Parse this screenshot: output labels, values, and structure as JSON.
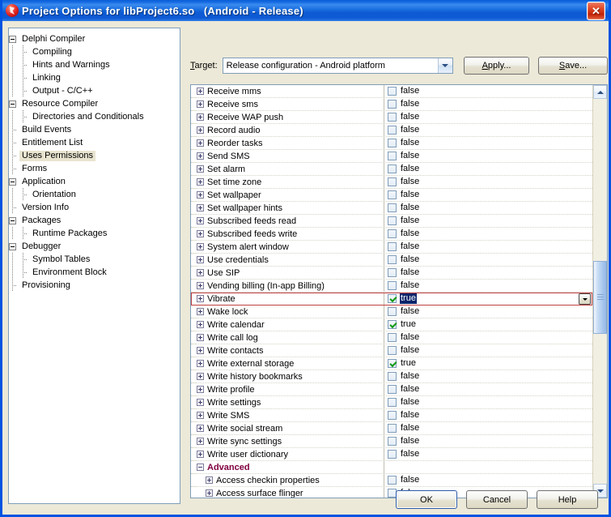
{
  "window": {
    "title": "Project Options for libProject6.so   (Android - Release)",
    "icon": "delphi-icon",
    "close_label": "✕"
  },
  "tree": {
    "items": [
      {
        "label": "Delphi Compiler",
        "level": 0,
        "expander": "minus",
        "selected": false
      },
      {
        "label": "Compiling",
        "level": 1,
        "expander": "none",
        "selected": false
      },
      {
        "label": "Hints and Warnings",
        "level": 1,
        "expander": "none",
        "selected": false
      },
      {
        "label": "Linking",
        "level": 1,
        "expander": "none",
        "selected": false
      },
      {
        "label": "Output - C/C++",
        "level": 1,
        "expander": "none",
        "selected": false
      },
      {
        "label": "Resource Compiler",
        "level": 0,
        "expander": "minus",
        "selected": false
      },
      {
        "label": "Directories and Conditionals",
        "level": 1,
        "expander": "none",
        "selected": false
      },
      {
        "label": "Build Events",
        "level": 0,
        "expander": "none",
        "selected": false
      },
      {
        "label": "Entitlement List",
        "level": 0,
        "expander": "none",
        "selected": false
      },
      {
        "label": "Uses Permissions",
        "level": 0,
        "expander": "none",
        "selected": true
      },
      {
        "label": "Forms",
        "level": 0,
        "expander": "none",
        "selected": false
      },
      {
        "label": "Application",
        "level": 0,
        "expander": "minus",
        "selected": false
      },
      {
        "label": "Orientation",
        "level": 1,
        "expander": "none",
        "selected": false
      },
      {
        "label": "Version Info",
        "level": 0,
        "expander": "none",
        "selected": false
      },
      {
        "label": "Packages",
        "level": 0,
        "expander": "minus",
        "selected": false
      },
      {
        "label": "Runtime Packages",
        "level": 1,
        "expander": "none",
        "selected": false
      },
      {
        "label": "Debugger",
        "level": 0,
        "expander": "minus",
        "selected": false
      },
      {
        "label": "Symbol Tables",
        "level": 1,
        "expander": "none",
        "selected": false
      },
      {
        "label": "Environment Block",
        "level": 1,
        "expander": "none",
        "selected": false
      },
      {
        "label": "Provisioning",
        "level": 0,
        "expander": "none",
        "selected": false
      }
    ]
  },
  "target": {
    "label": "Target:",
    "label_accel": "T",
    "value": "Release configuration - Android platform",
    "apply_label": "Apply...",
    "apply_accel": "A",
    "save_label": "Save...",
    "save_accel": "S"
  },
  "grid": {
    "rows": [
      {
        "name": "Receive mms",
        "value": "false",
        "checked": false,
        "group": false,
        "indent": 0,
        "selected": false
      },
      {
        "name": "Receive sms",
        "value": "false",
        "checked": false,
        "group": false,
        "indent": 0,
        "selected": false
      },
      {
        "name": "Receive WAP push",
        "value": "false",
        "checked": false,
        "group": false,
        "indent": 0,
        "selected": false
      },
      {
        "name": "Record audio",
        "value": "false",
        "checked": false,
        "group": false,
        "indent": 0,
        "selected": false
      },
      {
        "name": "Reorder tasks",
        "value": "false",
        "checked": false,
        "group": false,
        "indent": 0,
        "selected": false
      },
      {
        "name": "Send SMS",
        "value": "false",
        "checked": false,
        "group": false,
        "indent": 0,
        "selected": false
      },
      {
        "name": "Set alarm",
        "value": "false",
        "checked": false,
        "group": false,
        "indent": 0,
        "selected": false
      },
      {
        "name": "Set time zone",
        "value": "false",
        "checked": false,
        "group": false,
        "indent": 0,
        "selected": false
      },
      {
        "name": "Set wallpaper",
        "value": "false",
        "checked": false,
        "group": false,
        "indent": 0,
        "selected": false
      },
      {
        "name": "Set wallpaper hints",
        "value": "false",
        "checked": false,
        "group": false,
        "indent": 0,
        "selected": false
      },
      {
        "name": "Subscribed feeds read",
        "value": "false",
        "checked": false,
        "group": false,
        "indent": 0,
        "selected": false
      },
      {
        "name": "Subscribed feeds write",
        "value": "false",
        "checked": false,
        "group": false,
        "indent": 0,
        "selected": false
      },
      {
        "name": "System alert window",
        "value": "false",
        "checked": false,
        "group": false,
        "indent": 0,
        "selected": false
      },
      {
        "name": "Use credentials",
        "value": "false",
        "checked": false,
        "group": false,
        "indent": 0,
        "selected": false
      },
      {
        "name": "Use SIP",
        "value": "false",
        "checked": false,
        "group": false,
        "indent": 0,
        "selected": false
      },
      {
        "name": "Vending billing (In-app Billing)",
        "value": "false",
        "checked": false,
        "group": false,
        "indent": 0,
        "selected": false
      },
      {
        "name": "Vibrate",
        "value": "true",
        "checked": true,
        "group": false,
        "indent": 0,
        "selected": true
      },
      {
        "name": "Wake lock",
        "value": "false",
        "checked": false,
        "group": false,
        "indent": 0,
        "selected": false
      },
      {
        "name": "Write calendar",
        "value": "true",
        "checked": true,
        "group": false,
        "indent": 0,
        "selected": false
      },
      {
        "name": "Write call log",
        "value": "false",
        "checked": false,
        "group": false,
        "indent": 0,
        "selected": false
      },
      {
        "name": "Write contacts",
        "value": "false",
        "checked": false,
        "group": false,
        "indent": 0,
        "selected": false
      },
      {
        "name": "Write external storage",
        "value": "true",
        "checked": true,
        "group": false,
        "indent": 0,
        "selected": false
      },
      {
        "name": "Write history bookmarks",
        "value": "false",
        "checked": false,
        "group": false,
        "indent": 0,
        "selected": false
      },
      {
        "name": "Write profile",
        "value": "false",
        "checked": false,
        "group": false,
        "indent": 0,
        "selected": false
      },
      {
        "name": "Write settings",
        "value": "false",
        "checked": false,
        "group": false,
        "indent": 0,
        "selected": false
      },
      {
        "name": "Write SMS",
        "value": "false",
        "checked": false,
        "group": false,
        "indent": 0,
        "selected": false
      },
      {
        "name": "Write social stream",
        "value": "false",
        "checked": false,
        "group": false,
        "indent": 0,
        "selected": false
      },
      {
        "name": "Write sync settings",
        "value": "false",
        "checked": false,
        "group": false,
        "indent": 0,
        "selected": false
      },
      {
        "name": "Write user dictionary",
        "value": "false",
        "checked": false,
        "group": false,
        "indent": 0,
        "selected": false
      },
      {
        "name": "Advanced",
        "value": "",
        "checked": false,
        "group": true,
        "indent": 0,
        "selected": false
      },
      {
        "name": "Access checkin properties",
        "value": "false",
        "checked": false,
        "group": false,
        "indent": 1,
        "selected": false
      },
      {
        "name": "Access surface flinger",
        "value": "false",
        "checked": false,
        "group": false,
        "indent": 1,
        "selected": false
      }
    ]
  },
  "footer": {
    "ok_label": "OK",
    "cancel_label": "Cancel",
    "help_label": "Help"
  },
  "colors": {
    "titlebar": "#0a5fd6",
    "window_face": "#ece9d8",
    "selection_frame": "#c04040",
    "selection_highlight": "#0a246a",
    "group_header": "#800040",
    "check_green": "#139a13"
  }
}
